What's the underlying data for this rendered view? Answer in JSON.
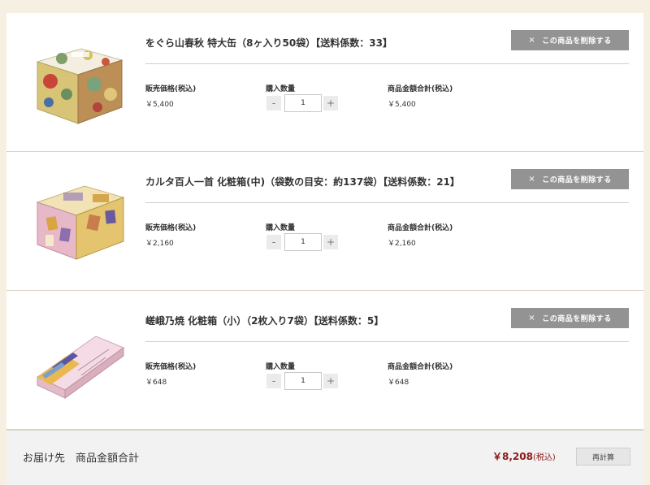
{
  "cart": {
    "items": [
      {
        "title": "をぐら山春秋 特大缶（8ヶ入り50袋）【送料係数：33】",
        "delete_label": "この商品を削除する",
        "price_label": "販売価格(税込)",
        "price": "￥5,400",
        "qty_label": "購入数量",
        "qty": "1",
        "subtotal_label": "商品金額合計(税込)",
        "subtotal": "￥5,400",
        "image": "item-1-product-image"
      },
      {
        "title": "カルタ百人一首 化粧箱(中)（袋数の目安：約137袋）【送料係数：21】",
        "delete_label": "この商品を削除する",
        "price_label": "販売価格(税込)",
        "price": "￥2,160",
        "qty_label": "購入数量",
        "qty": "1",
        "subtotal_label": "商品金額合計(税込)",
        "subtotal": "￥2,160",
        "image": "item-2-product-image"
      },
      {
        "title": "嵯峨乃焼 化粧箱（小）（2枚入り7袋）【送料係数：5】",
        "delete_label": "この商品を削除する",
        "price_label": "販売価格(税込)",
        "price": "￥648",
        "qty_label": "購入数量",
        "qty": "1",
        "subtotal_label": "商品金額合計(税込)",
        "subtotal": "￥648",
        "image": "item-3-product-image"
      }
    ],
    "stepper": {
      "minus": "-",
      "plus": "+"
    },
    "delete_icon": "×"
  },
  "footer": {
    "label": "お届け先　商品金額合計",
    "total": "￥8,208",
    "tax_note": "(税込)",
    "recalc_label": "再計算"
  }
}
